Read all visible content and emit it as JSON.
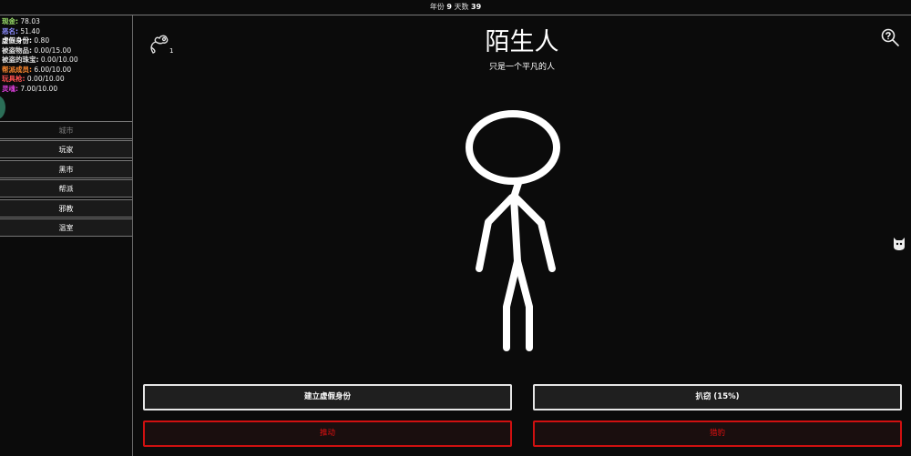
{
  "topbar": {
    "year_label": "年份",
    "year_value": "9",
    "day_label": "天数",
    "day_value": "39"
  },
  "stats": [
    {
      "label": "现金:",
      "value": "78.03",
      "color": "#9be06b"
    },
    {
      "label": "恶名:",
      "value": "51.40",
      "color": "#8c8cff"
    },
    {
      "label": "虚假身份:",
      "value": "0.80",
      "color": "#ffffff"
    },
    {
      "label": "被盗物品:",
      "value": "0.00/15.00",
      "color": "#e0e0e0"
    },
    {
      "label": "被盗的珠宝:",
      "value": "0.00/10.00",
      "color": "#e0e0e0"
    },
    {
      "label": "帮派成员:",
      "value": "6.00/10.00",
      "color": "#ff8a30"
    },
    {
      "label": "玩具枪:",
      "value": "0.00/10.00",
      "color": "#ff5050"
    },
    {
      "label": "灵魂:",
      "value": "7.00/10.00",
      "color": "#e040e0"
    }
  ],
  "nav": [
    "城市",
    "玩家",
    "黑市",
    "帮派",
    "邪教",
    "温室"
  ],
  "character": {
    "name": "陌生人",
    "description": "只是一个平凡的人"
  },
  "inventory": {
    "count": "1"
  },
  "actions": {
    "forge_identity": "建立虚假身份",
    "pickpocket": "扒窃 (15%)",
    "push": "推动",
    "mug": "猎豹"
  }
}
